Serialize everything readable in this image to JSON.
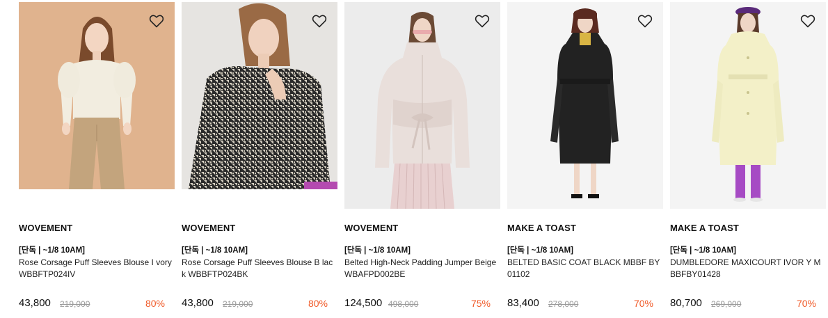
{
  "products": [
    {
      "image_label": "white blouse model on tan background",
      "brand": "WOVEMENT",
      "badge": "[단독 | ~1/8 10AM]",
      "name": "Rose Corsage Puff Sleeves Blouse I vory WBBFTP024IV",
      "price": "43,800",
      "original_price": "219,000",
      "discount": "80%"
    },
    {
      "image_label": "black houndstooth blouse model",
      "brand": "WOVEMENT",
      "badge": "[단독 | ~1/8 10AM]",
      "name": "Rose Corsage Puff Sleeves Blouse B lack WBBFTP024BK",
      "price": "43,800",
      "original_price": "219,000",
      "discount": "80%"
    },
    {
      "image_label": "beige padding jumper model",
      "brand": "WOVEMENT",
      "badge": "[단독 | ~1/8 10AM]",
      "name": "Belted High-Neck Padding Jumper Beige WBAFPD002BE",
      "price": "124,500",
      "original_price": "498,000",
      "discount": "75%"
    },
    {
      "image_label": "black belted coat model",
      "brand": "MAKE A TOAST",
      "badge": "[단독 | ~1/8 10AM]",
      "name": "BELTED BASIC COAT BLACK MBBF BY01102",
      "price": "83,400",
      "original_price": "278,000",
      "discount": "70%"
    },
    {
      "image_label": "ivory maxi coat model",
      "brand": "MAKE A TOAST",
      "badge": "[단독 | ~1/8 10AM]",
      "name": "DUMBLEDORE MAXICOURT IVOR Y MBBFBY01428",
      "price": "80,700",
      "original_price": "269,000",
      "discount": "70%"
    }
  ],
  "icons": {
    "wishlist": "heart-outline-icon"
  },
  "colors": {
    "discount": "#f05a28",
    "original_price": "#9a9a9a",
    "text": "#111111"
  }
}
